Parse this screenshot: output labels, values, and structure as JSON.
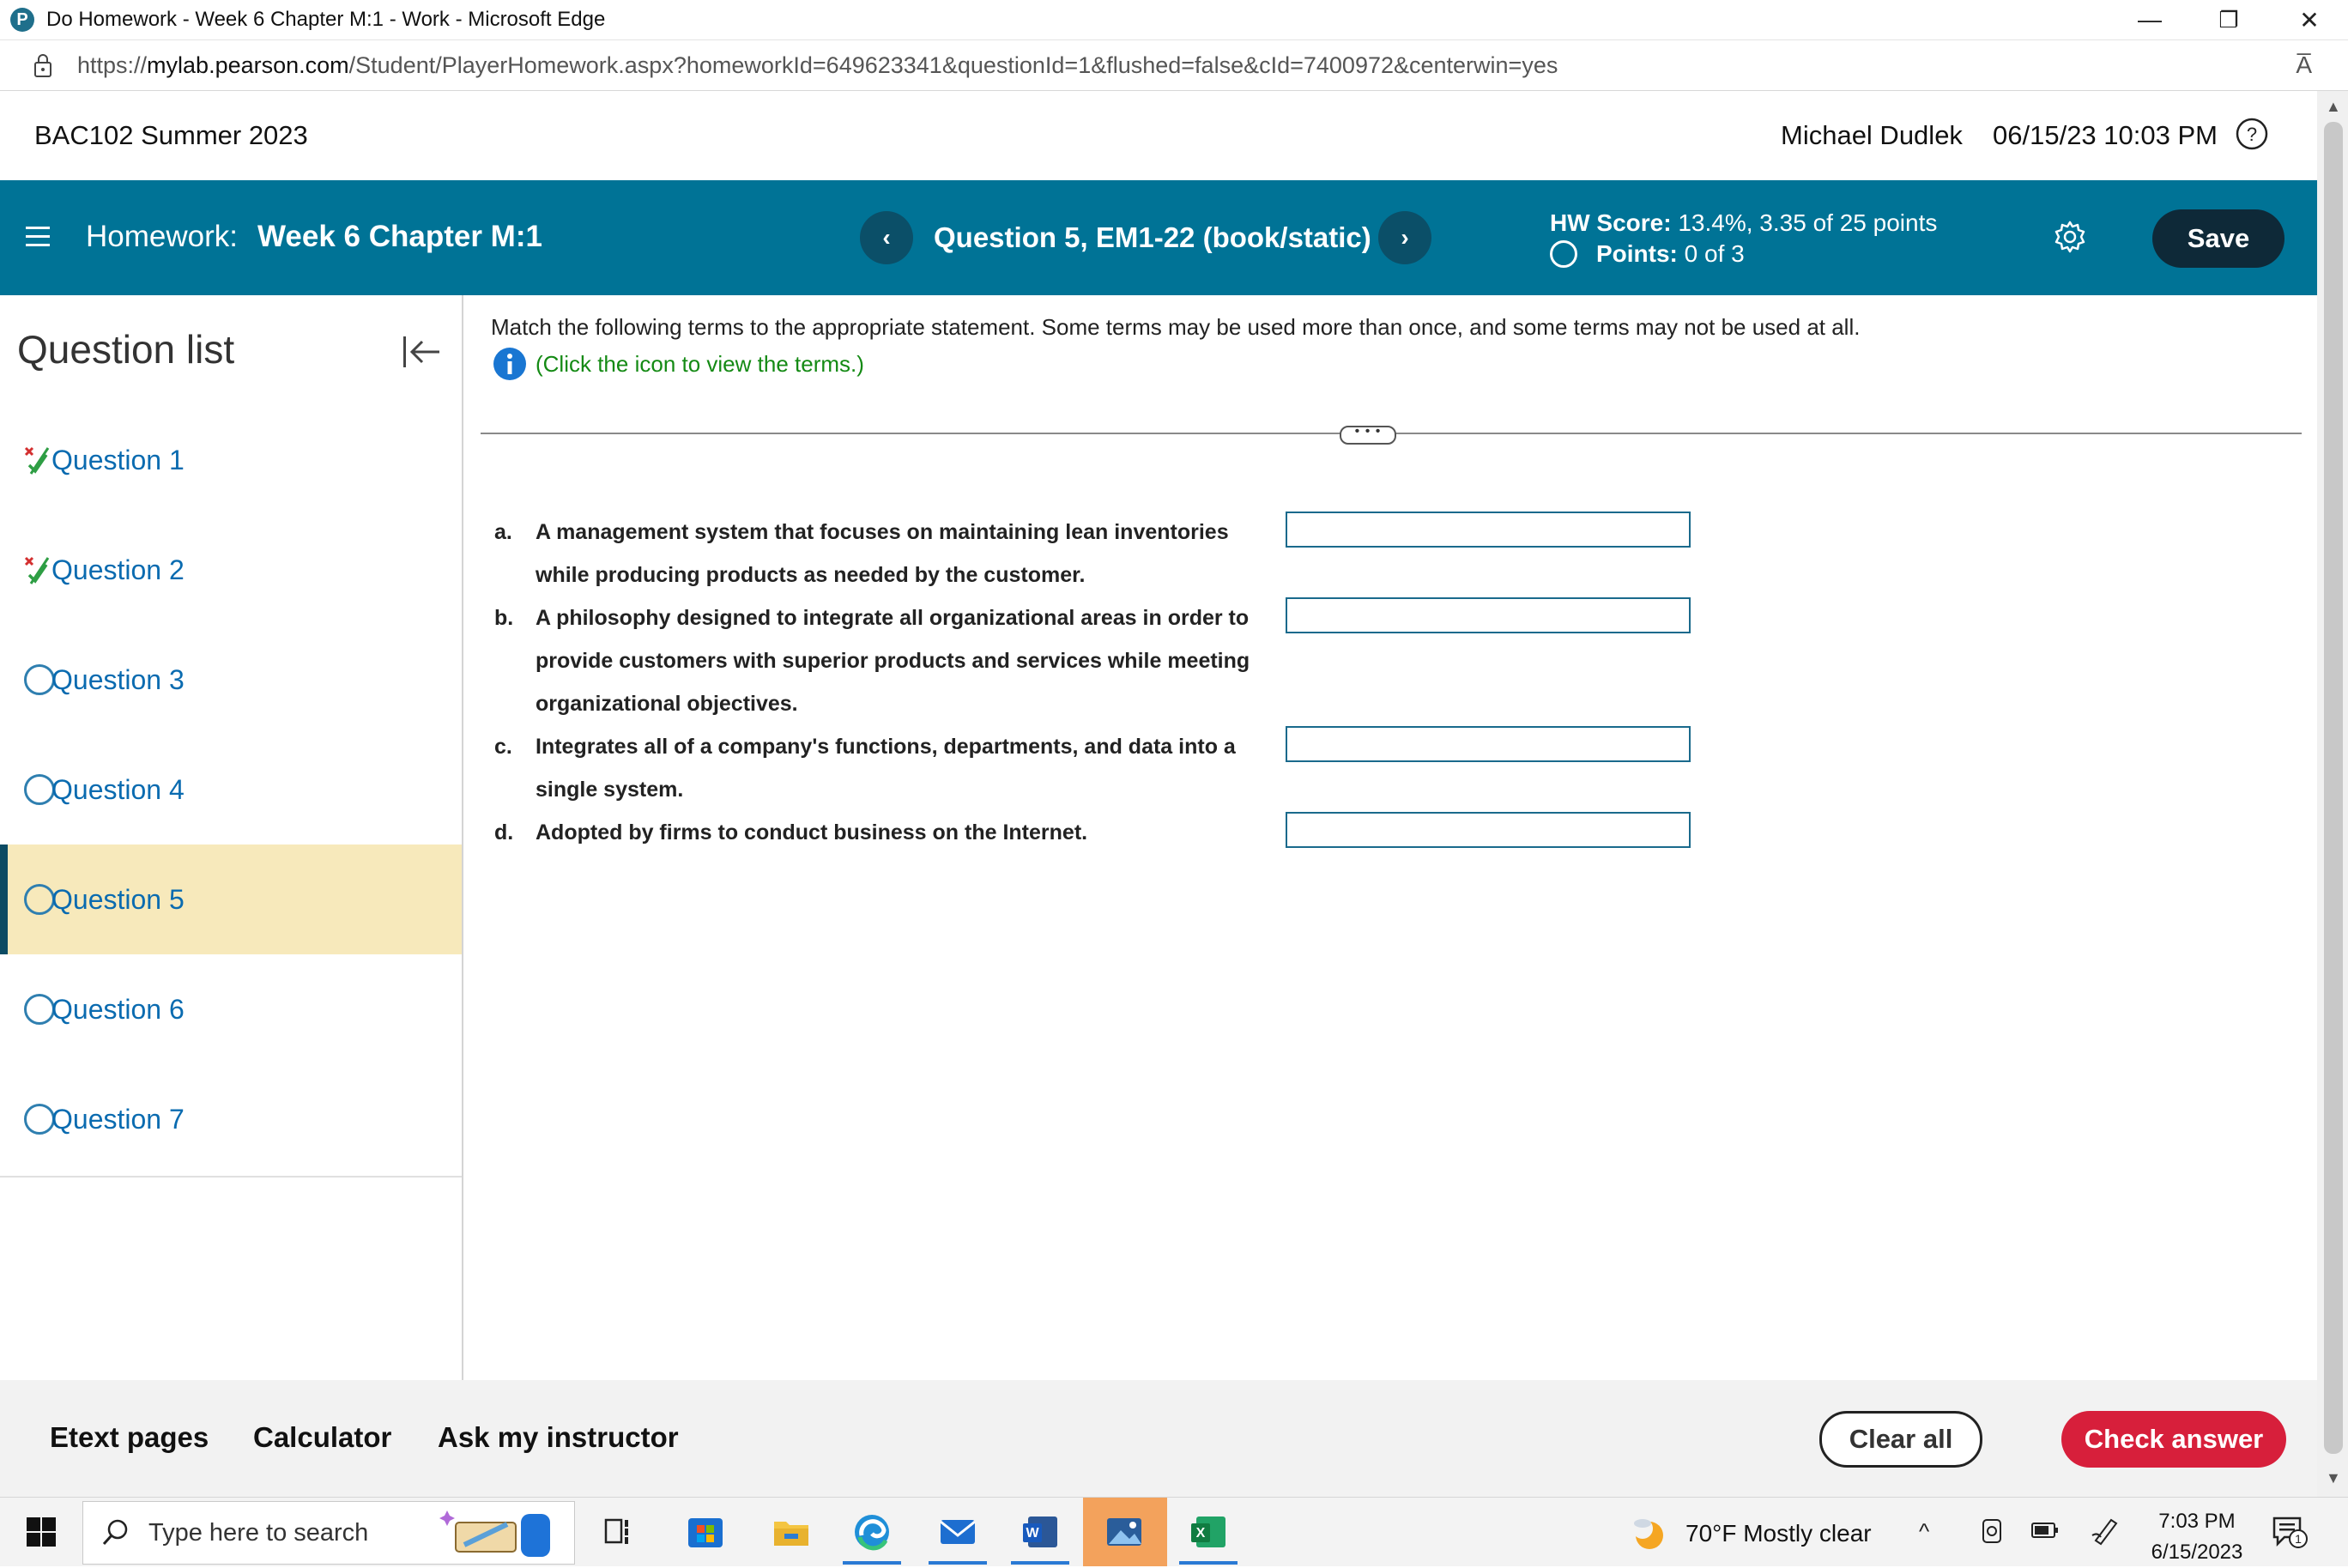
{
  "browser": {
    "window_title": "Do Homework - Week 6 Chapter M:1 - Work - Microsoft Edge",
    "url_prefix": "https://",
    "url_domain": "mylab.pearson.com",
    "url_path": "/Student/PlayerHomework.aspx?homeworkId=649623341&questionId=1&flushed=false&cId=7400972&centerwin=yes",
    "read_aloud_label": "A̅",
    "minimize": "—",
    "restore": "❐",
    "close": "✕"
  },
  "header": {
    "course": "BAC102 Summer 2023",
    "user": "Michael Dudlek",
    "datetime": "06/15/23 10:03 PM"
  },
  "homework_bar": {
    "label": "Homework:",
    "name": "Week 6 Chapter M:1",
    "prev_label": "‹",
    "next_label": "›",
    "question": "Question 5, EM1-22 (book/static)",
    "score_label": "HW Score:",
    "score_value": "13.4%, 3.35 of 25 points",
    "points_label": "Points:",
    "points_value": "0 of 3",
    "save_label": "Save"
  },
  "sidebar": {
    "title": "Question list",
    "questions": [
      {
        "label": "Question 1",
        "status": "partial"
      },
      {
        "label": "Question 2",
        "status": "partial"
      },
      {
        "label": "Question 3",
        "status": "unanswered"
      },
      {
        "label": "Question 4",
        "status": "unanswered"
      },
      {
        "label": "Question 5",
        "status": "current"
      },
      {
        "label": "Question 6",
        "status": "unanswered"
      },
      {
        "label": "Question 7",
        "status": "unanswered"
      }
    ]
  },
  "question": {
    "instructions": "Match the following terms to the appropriate statement. Some terms may be used more than once, and some terms may not be used at all.",
    "terms_link": "(Click the icon to view the terms.)",
    "more_label": "• • •",
    "statements": [
      {
        "letter": "a.",
        "lines": [
          "A management system that focuses on maintaining lean inventories",
          "while producing products as needed by the customer."
        ],
        "answer": ""
      },
      {
        "letter": "b.",
        "lines": [
          "A philosophy designed to integrate all organizational areas in order to",
          "provide customers with superior products and services while meeting",
          "organizational objectives."
        ],
        "answer": ""
      },
      {
        "letter": "c.",
        "lines": [
          "Integrates all of a company's functions, departments, and data into a",
          "single system."
        ],
        "answer": ""
      },
      {
        "letter": "d.",
        "lines": [
          "Adopted by firms to conduct business on the Internet."
        ],
        "answer": ""
      }
    ]
  },
  "footer": {
    "etext": "Etext pages",
    "calculator": "Calculator",
    "ask": "Ask my instructor",
    "clear_all": "Clear all",
    "check_answer": "Check answer"
  },
  "taskbar": {
    "search_placeholder": "Type here to search",
    "weather": "70°F  Mostly clear",
    "tray_chevron": "^",
    "time": "7:03 PM",
    "date": "6/15/2023",
    "notification_count": "1"
  },
  "colors": {
    "accent_teal": "#007396",
    "nav_dark": "#0b4f68",
    "save_bg": "#0e2938",
    "active_question_bg": "#f7e9bb",
    "check_answer_red": "#d71f3b",
    "link_blue": "#0a6bb0",
    "terms_green": "#148a14"
  }
}
